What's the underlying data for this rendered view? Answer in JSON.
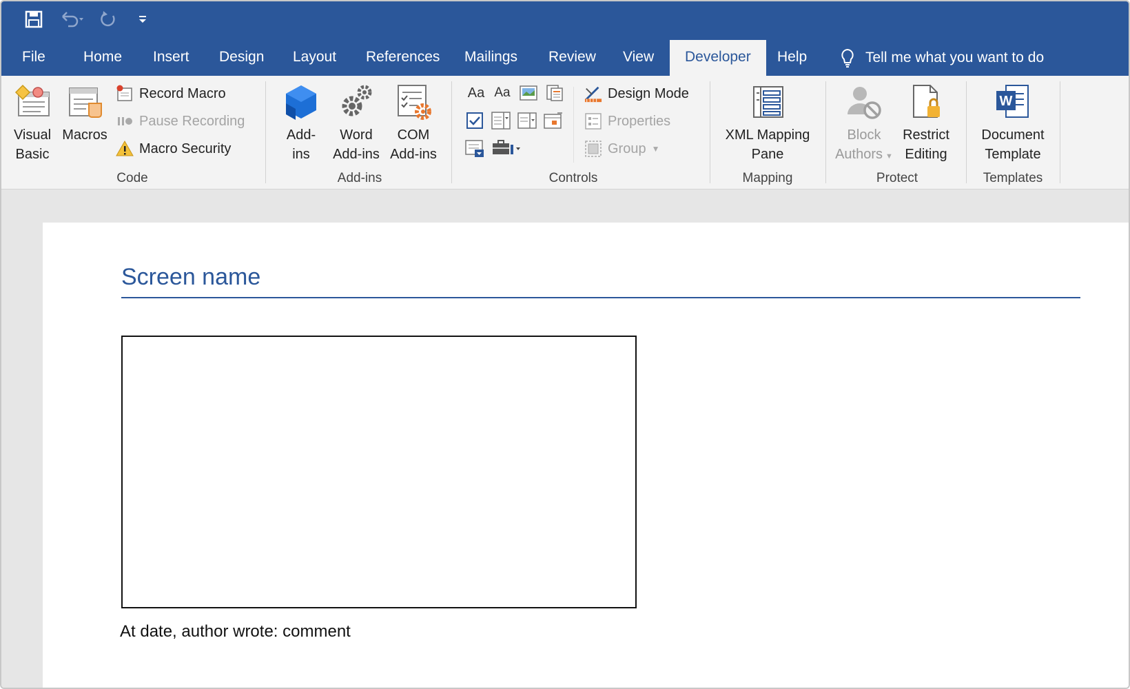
{
  "qat": {
    "save_icon": "save-icon",
    "undo_icon": "undo-icon",
    "redo_icon": "redo-icon",
    "customize_icon": "customize-qat-icon"
  },
  "tabs": [
    {
      "label": "File"
    },
    {
      "label": "Home"
    },
    {
      "label": "Insert"
    },
    {
      "label": "Design"
    },
    {
      "label": "Layout"
    },
    {
      "label": "References"
    },
    {
      "label": "Mailings"
    },
    {
      "label": "Review"
    },
    {
      "label": "View"
    },
    {
      "label": "Developer",
      "active": true
    },
    {
      "label": "Help"
    }
  ],
  "tell_me": {
    "label": "Tell me what you want to do",
    "icon": "lightbulb-icon"
  },
  "ribbon": {
    "code": {
      "label": "Code",
      "visual_basic": "Visual\nBasic",
      "visual_basic_l1": "Visual",
      "visual_basic_l2": "Basic",
      "macros": "Macros",
      "record_macro": "Record Macro",
      "pause_recording": "Pause Recording",
      "macro_security": "Macro Security"
    },
    "addins": {
      "label": "Add-ins",
      "addins_l1": "Add-",
      "addins_l2": "ins",
      "word_addins_l1": "Word",
      "word_addins_l2": "Add-ins",
      "com_addins_l1": "COM",
      "com_addins_l2": "Add-ins"
    },
    "controls": {
      "label": "Controls",
      "rich_text": "Aa",
      "plain_text": "Aa",
      "design_mode": "Design Mode",
      "properties": "Properties",
      "group": "Group"
    },
    "mapping": {
      "label": "Mapping",
      "xml_l1": "XML Mapping",
      "xml_l2": "Pane"
    },
    "protect": {
      "label": "Protect",
      "block_l1": "Block",
      "block_l2": "Authors",
      "restrict_l1": "Restrict",
      "restrict_l2": "Editing"
    },
    "templates": {
      "label": "Templates",
      "doc_l1": "Document",
      "doc_l2": "Template"
    }
  },
  "document": {
    "heading": "Screen name",
    "caption": "At date, author wrote: comment"
  },
  "colors": {
    "brand": "#2b579a",
    "ribbon_bg": "#f3f3f3"
  }
}
